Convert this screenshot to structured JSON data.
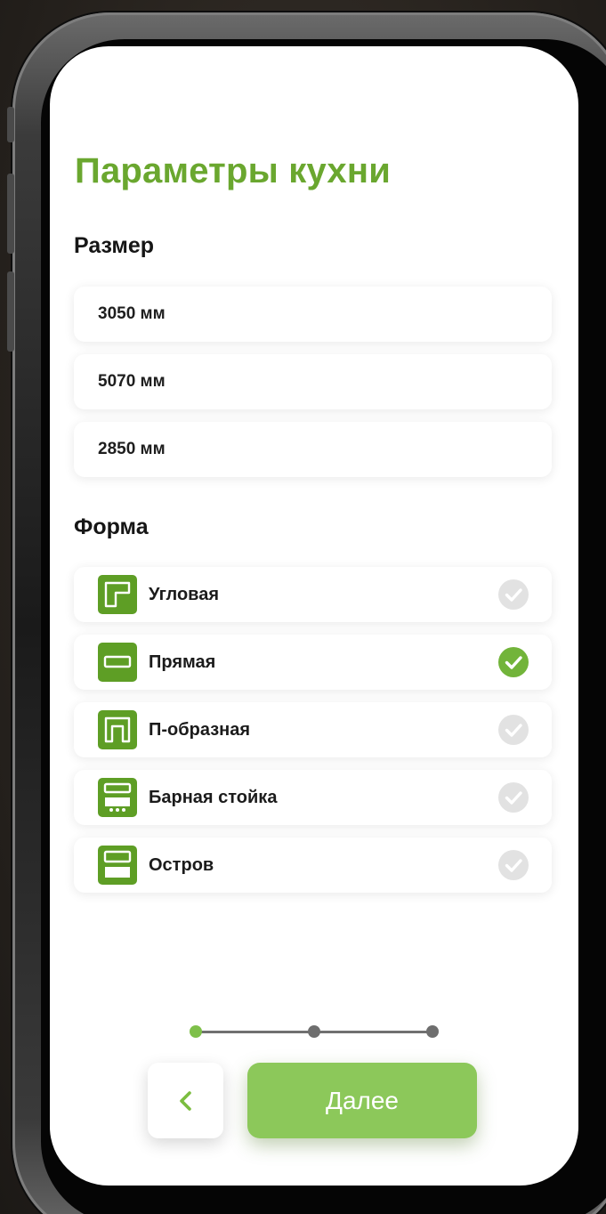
{
  "screen": {
    "title": "Параметры кухни",
    "size_section_label": "Размер",
    "sizes": [
      "3050 мм",
      "5070 мм",
      "2850 мм"
    ],
    "shape_section_label": "Форма",
    "shapes": [
      {
        "label": "Угловая",
        "icon": "corner-kitchen-icon",
        "selected": false
      },
      {
        "label": "Прямая",
        "icon": "straight-kitchen-icon",
        "selected": true
      },
      {
        "label": "П-образная",
        "icon": "u-shaped-kitchen-icon",
        "selected": false
      },
      {
        "label": "Барная стойка",
        "icon": "bar-counter-icon",
        "selected": false
      },
      {
        "label": "Остров",
        "icon": "island-kitchen-icon",
        "selected": false
      }
    ],
    "progress": {
      "total_steps": 3,
      "current_step": 1
    },
    "back_icon": "chevron-left-icon",
    "next_label": "Далее"
  },
  "colors": {
    "accent": "#6aa72f",
    "button": "#8cc85a",
    "check_on": "#72b43a",
    "check_off": "#e2e2e2"
  }
}
